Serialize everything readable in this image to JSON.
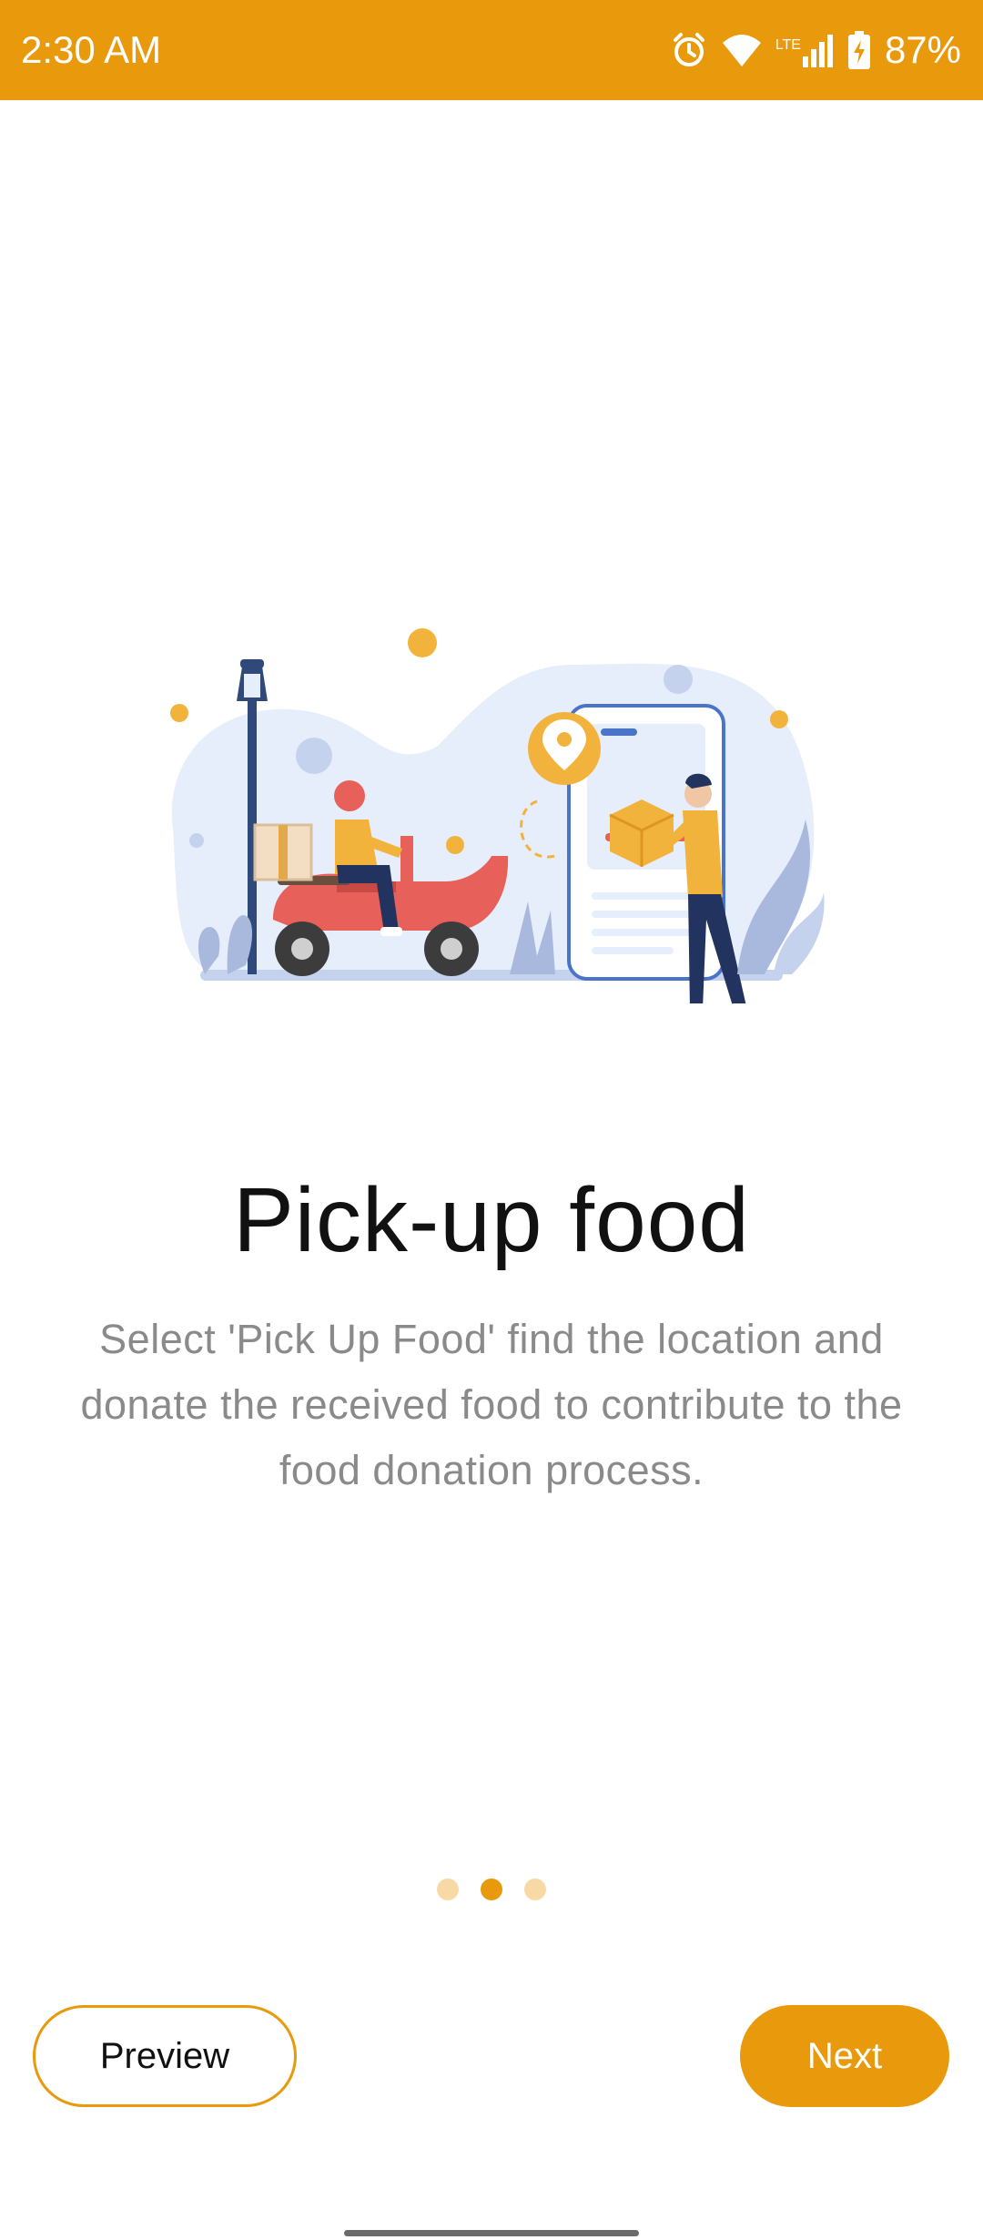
{
  "status_bar": {
    "time": "2:30 AM",
    "battery_percent": "87%",
    "network_label": "LTE",
    "icons": [
      "alarm-icon",
      "wifi-icon",
      "lte-signal-icon",
      "battery-charging-icon"
    ],
    "background_color": "#E89A0C"
  },
  "onboarding": {
    "illustration": "scooter-delivery-with-phone-map-pin-illustration",
    "title": "Pick-up food",
    "description": "Select 'Pick Up Food' find the location and donate the received food to contribute to the food donation process.",
    "pagination": {
      "total": 3,
      "active_index": 1,
      "active_color": "#E89A0C",
      "inactive_color": "#F8D9A6"
    }
  },
  "footer": {
    "preview_label": "Preview",
    "next_label": "Next"
  },
  "colors": {
    "accent": "#E89A0C",
    "title_text": "#111111",
    "description_text": "#8a8a8a"
  }
}
